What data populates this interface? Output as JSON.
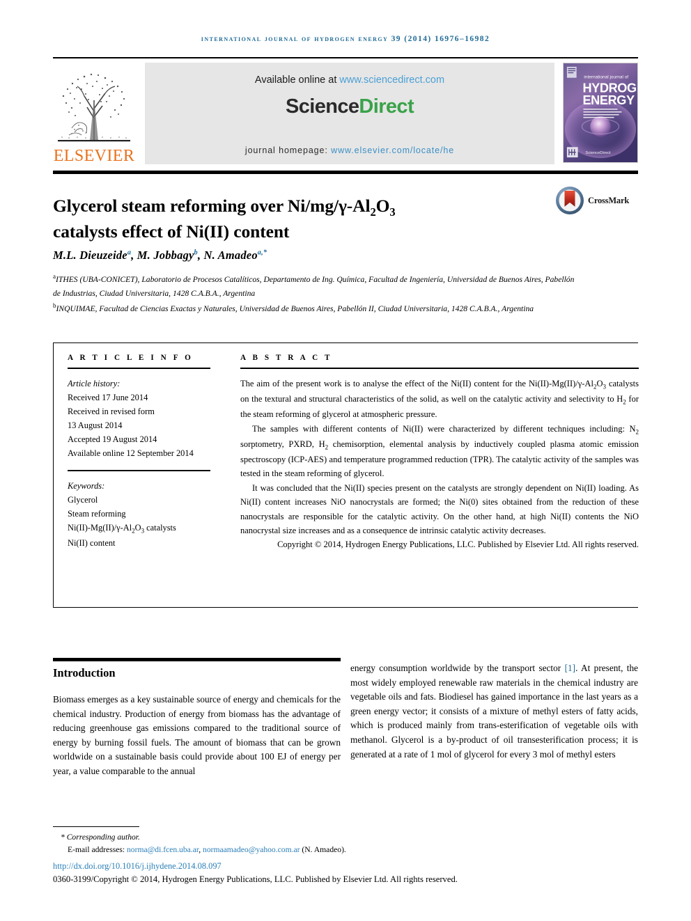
{
  "running_head": "International Journal of Hydrogen Energy 39 (2014) 16976–16982",
  "masthead": {
    "available_prefix": "Available online at ",
    "sciencedirect_url": "www.sciencedirect.com",
    "sciencedirect_logo_science": "Science",
    "sciencedirect_logo_direct": "Direct",
    "homepage_label": "journal homepage: ",
    "homepage_url": "www.elsevier.com/locate/he",
    "elsevier_word": "ELSEVIER",
    "cover": {
      "line1": "international journal of",
      "line2": "HYDROGEN",
      "line3": "ENERGY",
      "footer": "ScienceDirect"
    }
  },
  "article": {
    "title_line1_a": "Glycerol steam reforming over Ni/mg/γ-Al",
    "title_line1_sub1": "2",
    "title_line1_b": "O",
    "title_line1_sub2": "3",
    "title_line2": "catalysts effect of Ni(II) content",
    "crossmark_label": "CrossMark",
    "authors": [
      {
        "name": "M.L. Dieuzeide",
        "sup": "a"
      },
      {
        "name": "M. Jobbagy",
        "sup": "b"
      },
      {
        "name": "N. Amadeo",
        "sup": "a,*"
      }
    ],
    "affiliations": [
      {
        "marker": "a",
        "text": "ITHES (UBA-CONICET), Laboratorio de Procesos Catalíticos, Departamento de Ing. Química, Facultad de Ingeniería, Universidad de Buenos Aires, Pabellón de Industrias, Ciudad Universitaria, 1428 C.A.B.A., Argentina"
      },
      {
        "marker": "b",
        "text": "INQUIMAE, Facultad de Ciencias Exactas y Naturales, Universidad de Buenos Aires, Pabellón II, Ciudad Universitaria, 1428 C.A.B.A., Argentina"
      }
    ]
  },
  "info": {
    "label": "A R T I C L E   I N F O",
    "history_label": "Article history:",
    "history": [
      "Received 17 June 2014",
      "Received in revised form",
      "13 August 2014",
      "Accepted 19 August 2014",
      "Available online 12 September 2014"
    ],
    "keywords_label": "Keywords:",
    "keywords_plain": [
      "Glycerol",
      "Steam reforming"
    ],
    "keyword_catalysts_a": "Ni(II)-Mg(II)/γ-Al",
    "keyword_catalysts_sub": "2",
    "keyword_catalysts_b": "O",
    "keyword_catalysts_sub2": "3",
    "keyword_catalysts_c": " catalysts",
    "keyword_last": "Ni(II) content"
  },
  "abstract": {
    "label": "A B S T R A C T",
    "p1_a": "The aim of the present work is to analyse the effect of the Ni(II) content for the Ni(II)-Mg(II)/γ-Al",
    "p1_sub1": "2",
    "p1_b": "O",
    "p1_sub2": "3",
    "p1_c": " catalysts on the textural and structural characteristics of the solid, as well on the catalytic activity and selectivity to H",
    "p1_sub3": "2",
    "p1_d": " for the steam reforming of glycerol at atmospheric pressure.",
    "p2_a": "The samples with different contents of Ni(II) were characterized by different techniques including: N",
    "p2_sub1": "2",
    "p2_b": " sorptometry, PXRD, H",
    "p2_sub2": "2",
    "p2_c": " chemisorption, elemental analysis by inductively coupled plasma atomic emission spectroscopy (ICP-AES) and temperature programmed reduction (TPR). The catalytic activity of the samples was tested in the steam reforming of glycerol.",
    "p3": "It was concluded that the Ni(II) species present on the catalysts are strongly dependent on Ni(II) loading. As Ni(II) content increases NiO nanocrystals are formed; the Ni(0) sites obtained from the reduction of these nanocrystals are responsible for the catalytic activity. On the other hand, at high Ni(II) contents the NiO nanocrystal size increases and as a consequence de intrinsic catalytic activity decreases.",
    "copyright": "Copyright © 2014, Hydrogen Energy Publications, LLC. Published by Elsevier Ltd. All rights reserved."
  },
  "body": {
    "intro_heading": "Introduction",
    "left_paragraph": "Biomass emerges as a key sustainable source of energy and chemicals for the chemical industry. Production of energy from biomass has the advantage of reducing greenhouse gas emissions compared to the traditional source of energy by burning fossil fuels. The amount of biomass that can be grown worldwide on a sustainable basis could provide about 100 EJ of energy per year, a value comparable to the annual",
    "right_paragraph_a": "energy consumption worldwide by the transport sector ",
    "right_reference": "[1]",
    "right_paragraph_b": ". At present, the most widely employed renewable raw materials in the chemical industry are vegetable oils and fats. Biodiesel has gained importance in the last years as a green energy vector; it consists of a mixture of methyl esters of fatty acids, which is produced mainly from trans-esterification of vegetable oils with methanol. Glycerol is a by-product of oil transesterification process; it is generated at a rate of 1 mol of glycerol for every 3 mol of methyl esters"
  },
  "footer": {
    "corresponding": "* Corresponding author.",
    "email_label": "E-mail addresses: ",
    "email1": "norma@di.fcen.uba.ar",
    "email_sep": ", ",
    "email2": "normaamadeo@yahoo.com.ar",
    "email_suffix": " (N. Amadeo).",
    "doi": "http://dx.doi.org/10.1016/j.ijhydene.2014.08.097",
    "issn_copyright": "0360-3199/Copyright © 2014, Hydrogen Energy Publications, LLC. Published by Elsevier Ltd. All rights reserved."
  },
  "colors": {
    "journal_blue": "#1f6a96",
    "link_blue": "#2b7fb8",
    "sciencedirect_green": "#3aa24a",
    "elsevier_orange": "#E9711C",
    "crossmark_red": "#c0392b"
  }
}
